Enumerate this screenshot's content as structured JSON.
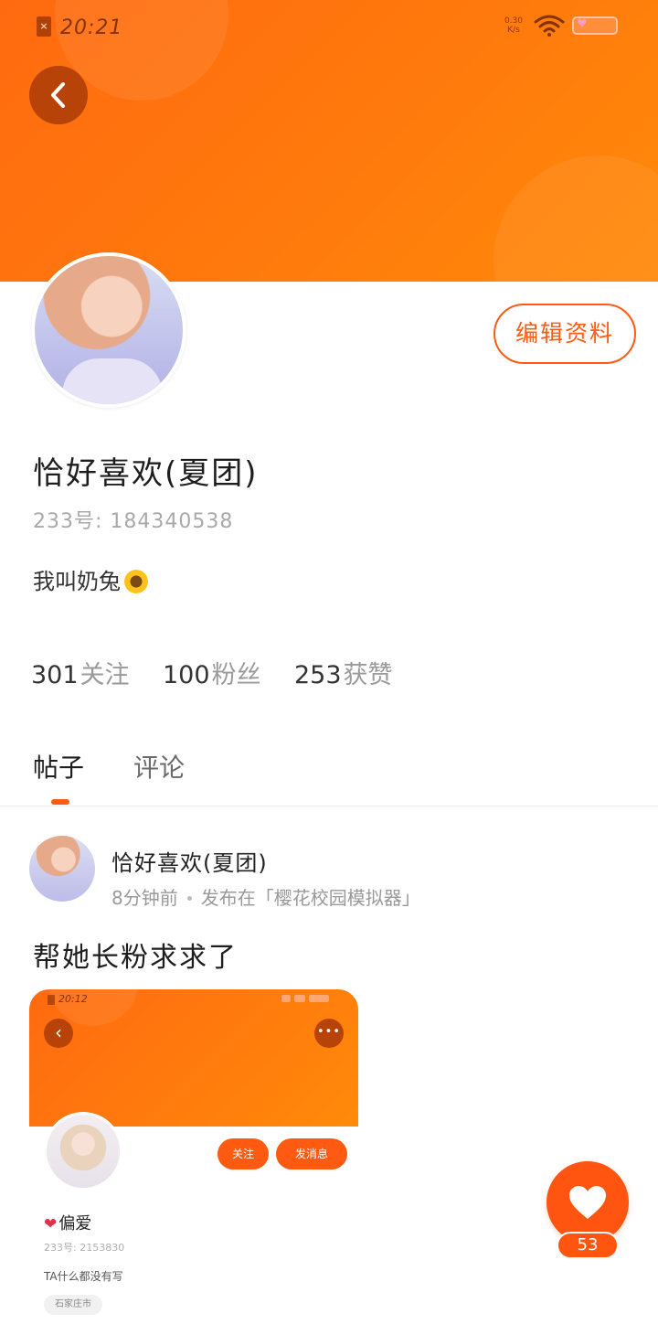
{
  "status_bar": {
    "time": "20:21",
    "sim_icon": "no-sim-icon",
    "network_speed": "0.30 K/s",
    "wifi_icon": "wifi-icon",
    "battery_icon": "battery-heart-icon"
  },
  "header": {
    "back_icon": "chevron-left-icon",
    "accent_color": "#ff6a10"
  },
  "profile": {
    "edit_label": "编辑资料",
    "username": "恰好喜欢(夏团)",
    "uid": "233号: 184340538",
    "bio": "我叫奶兔",
    "bio_emoji": "sunflower-icon",
    "stats": [
      {
        "num": "301",
        "label": "关注"
      },
      {
        "num": "100",
        "label": "粉丝"
      },
      {
        "num": "253",
        "label": "获赞"
      }
    ]
  },
  "tabs": [
    {
      "label": "帖子",
      "active": true
    },
    {
      "label": "评论",
      "active": false
    }
  ],
  "post": {
    "author": "恰好喜欢(夏团)",
    "time": "8分钟前",
    "forum": "发布在「樱花校园模拟器」",
    "text": "帮她长粉求求了",
    "screenshot": {
      "time": "20:12",
      "follow_label": "关注",
      "message_label": "发消息",
      "name": "偏爱",
      "uid": "233号: 2153830",
      "bio": "TA什么都没有写",
      "location": "石家庄市",
      "back_glyph": "‹",
      "more_glyph": "•••",
      "heart_glyph": "❤"
    }
  },
  "like": {
    "count": "53",
    "icon": "heart-icon"
  }
}
